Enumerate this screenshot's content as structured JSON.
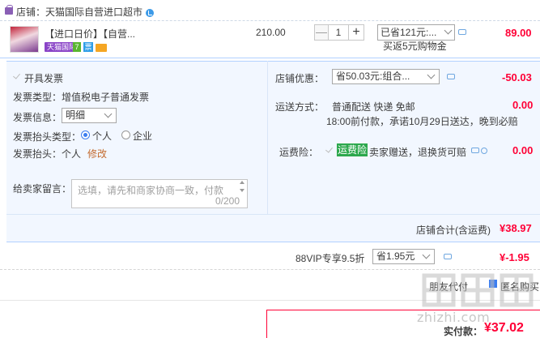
{
  "store": {
    "label": "店铺：天猫国际自营进口超市"
  },
  "item": {
    "title": "【进口日价】【自营...",
    "tag_tmall": "天猫国际",
    "tag_seven": "7",
    "tag_invoice": "票",
    "unit_price": "210.00",
    "qty_minus": "—",
    "quantity": "1",
    "qty_plus": "+",
    "discount_select": "已省121元:...",
    "rebate": "买返5元购物金",
    "total": "89.00"
  },
  "invoice": {
    "open_label": "开具发票",
    "type": "发票类型：增值税电子普通发票",
    "info_label": "发票信息：",
    "info_value": "明细",
    "header_type_label": "发票抬头类型：",
    "option_personal": "个人",
    "option_company": "企业",
    "header_text": "发票抬头：个人",
    "edit_link": "修改"
  },
  "message": {
    "label": "给卖家留言：",
    "placeholder": "选填，请先和商家协商一致，付款",
    "counter": "0/200"
  },
  "store_promo": {
    "label": "店铺优惠：",
    "select_value": "省50.03元:组合...",
    "amount": "-50.03"
  },
  "shipping": {
    "label": "运送方式：",
    "method": "普通配送 快递 免邮",
    "amount": "0.00",
    "note": "18:00前付款，承诺10月29日送达，晚到必赔"
  },
  "insurance": {
    "label": "运费险：",
    "badge": "运费险",
    "text": "卖家赠送，退换货可赔",
    "amount": "0.00"
  },
  "store_subtotal": {
    "label": "店铺合计(含运费)",
    "amount": "¥38.97"
  },
  "vip": {
    "label": "88VIP专享9.5折",
    "select_value": "省1.95元",
    "amount": "¥-1.95"
  },
  "footer": {
    "friend_pay": "朋友代付",
    "anonymous": "匿名购买",
    "pay_label": "实付款：",
    "pay_amount": "¥37.02"
  },
  "watermark": {
    "text": "zhizhi.com"
  },
  "colors": {
    "accent_red": "#ff0036",
    "panel_bg": "#f2f7ff",
    "panel_border": "#b2d1ff",
    "insurance_green": "#2da84d",
    "tmall_purple": "#8a44c7"
  }
}
